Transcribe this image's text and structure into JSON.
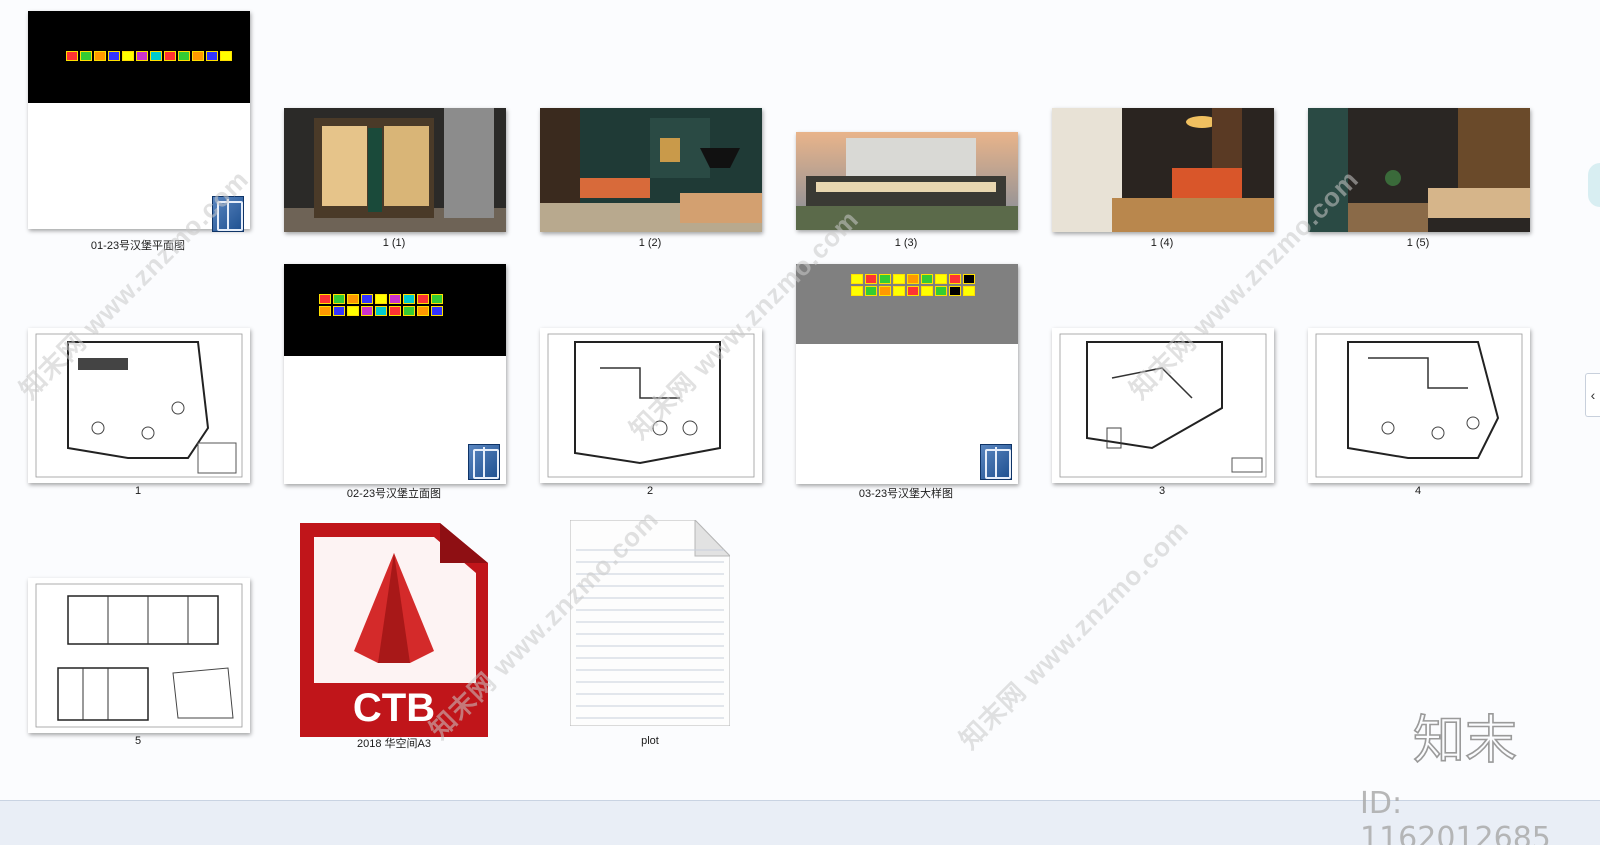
{
  "files": [
    {
      "label": "01-23号汉堡平面图",
      "kind": "dwg"
    },
    {
      "label": "1 (1)",
      "kind": "image"
    },
    {
      "label": "1 (2)",
      "kind": "image"
    },
    {
      "label": "1 (3)",
      "kind": "image"
    },
    {
      "label": "1 (4)",
      "kind": "image"
    },
    {
      "label": "1 (5)",
      "kind": "image"
    },
    {
      "label": "1",
      "kind": "plan"
    },
    {
      "label": "02-23号汉堡立面图",
      "kind": "dwg"
    },
    {
      "label": "2",
      "kind": "plan"
    },
    {
      "label": "03-23号汉堡大样图",
      "kind": "dwg"
    },
    {
      "label": "3",
      "kind": "plan"
    },
    {
      "label": "4",
      "kind": "plan"
    },
    {
      "label": "5",
      "kind": "plan"
    },
    {
      "label": "2018 华空间A3",
      "kind": "ctb"
    },
    {
      "label": "plot",
      "kind": "text"
    }
  ],
  "ctb_icon_text": "CTB",
  "watermark": {
    "text": "知末网 www.znzmo.com",
    "brand": "知末",
    "id": "ID: 1162012685"
  },
  "side_collapse_glyph": "‹",
  "colors": {
    "autocad_red": "#c0151a",
    "dwg_badge": "#1d4f8f"
  }
}
